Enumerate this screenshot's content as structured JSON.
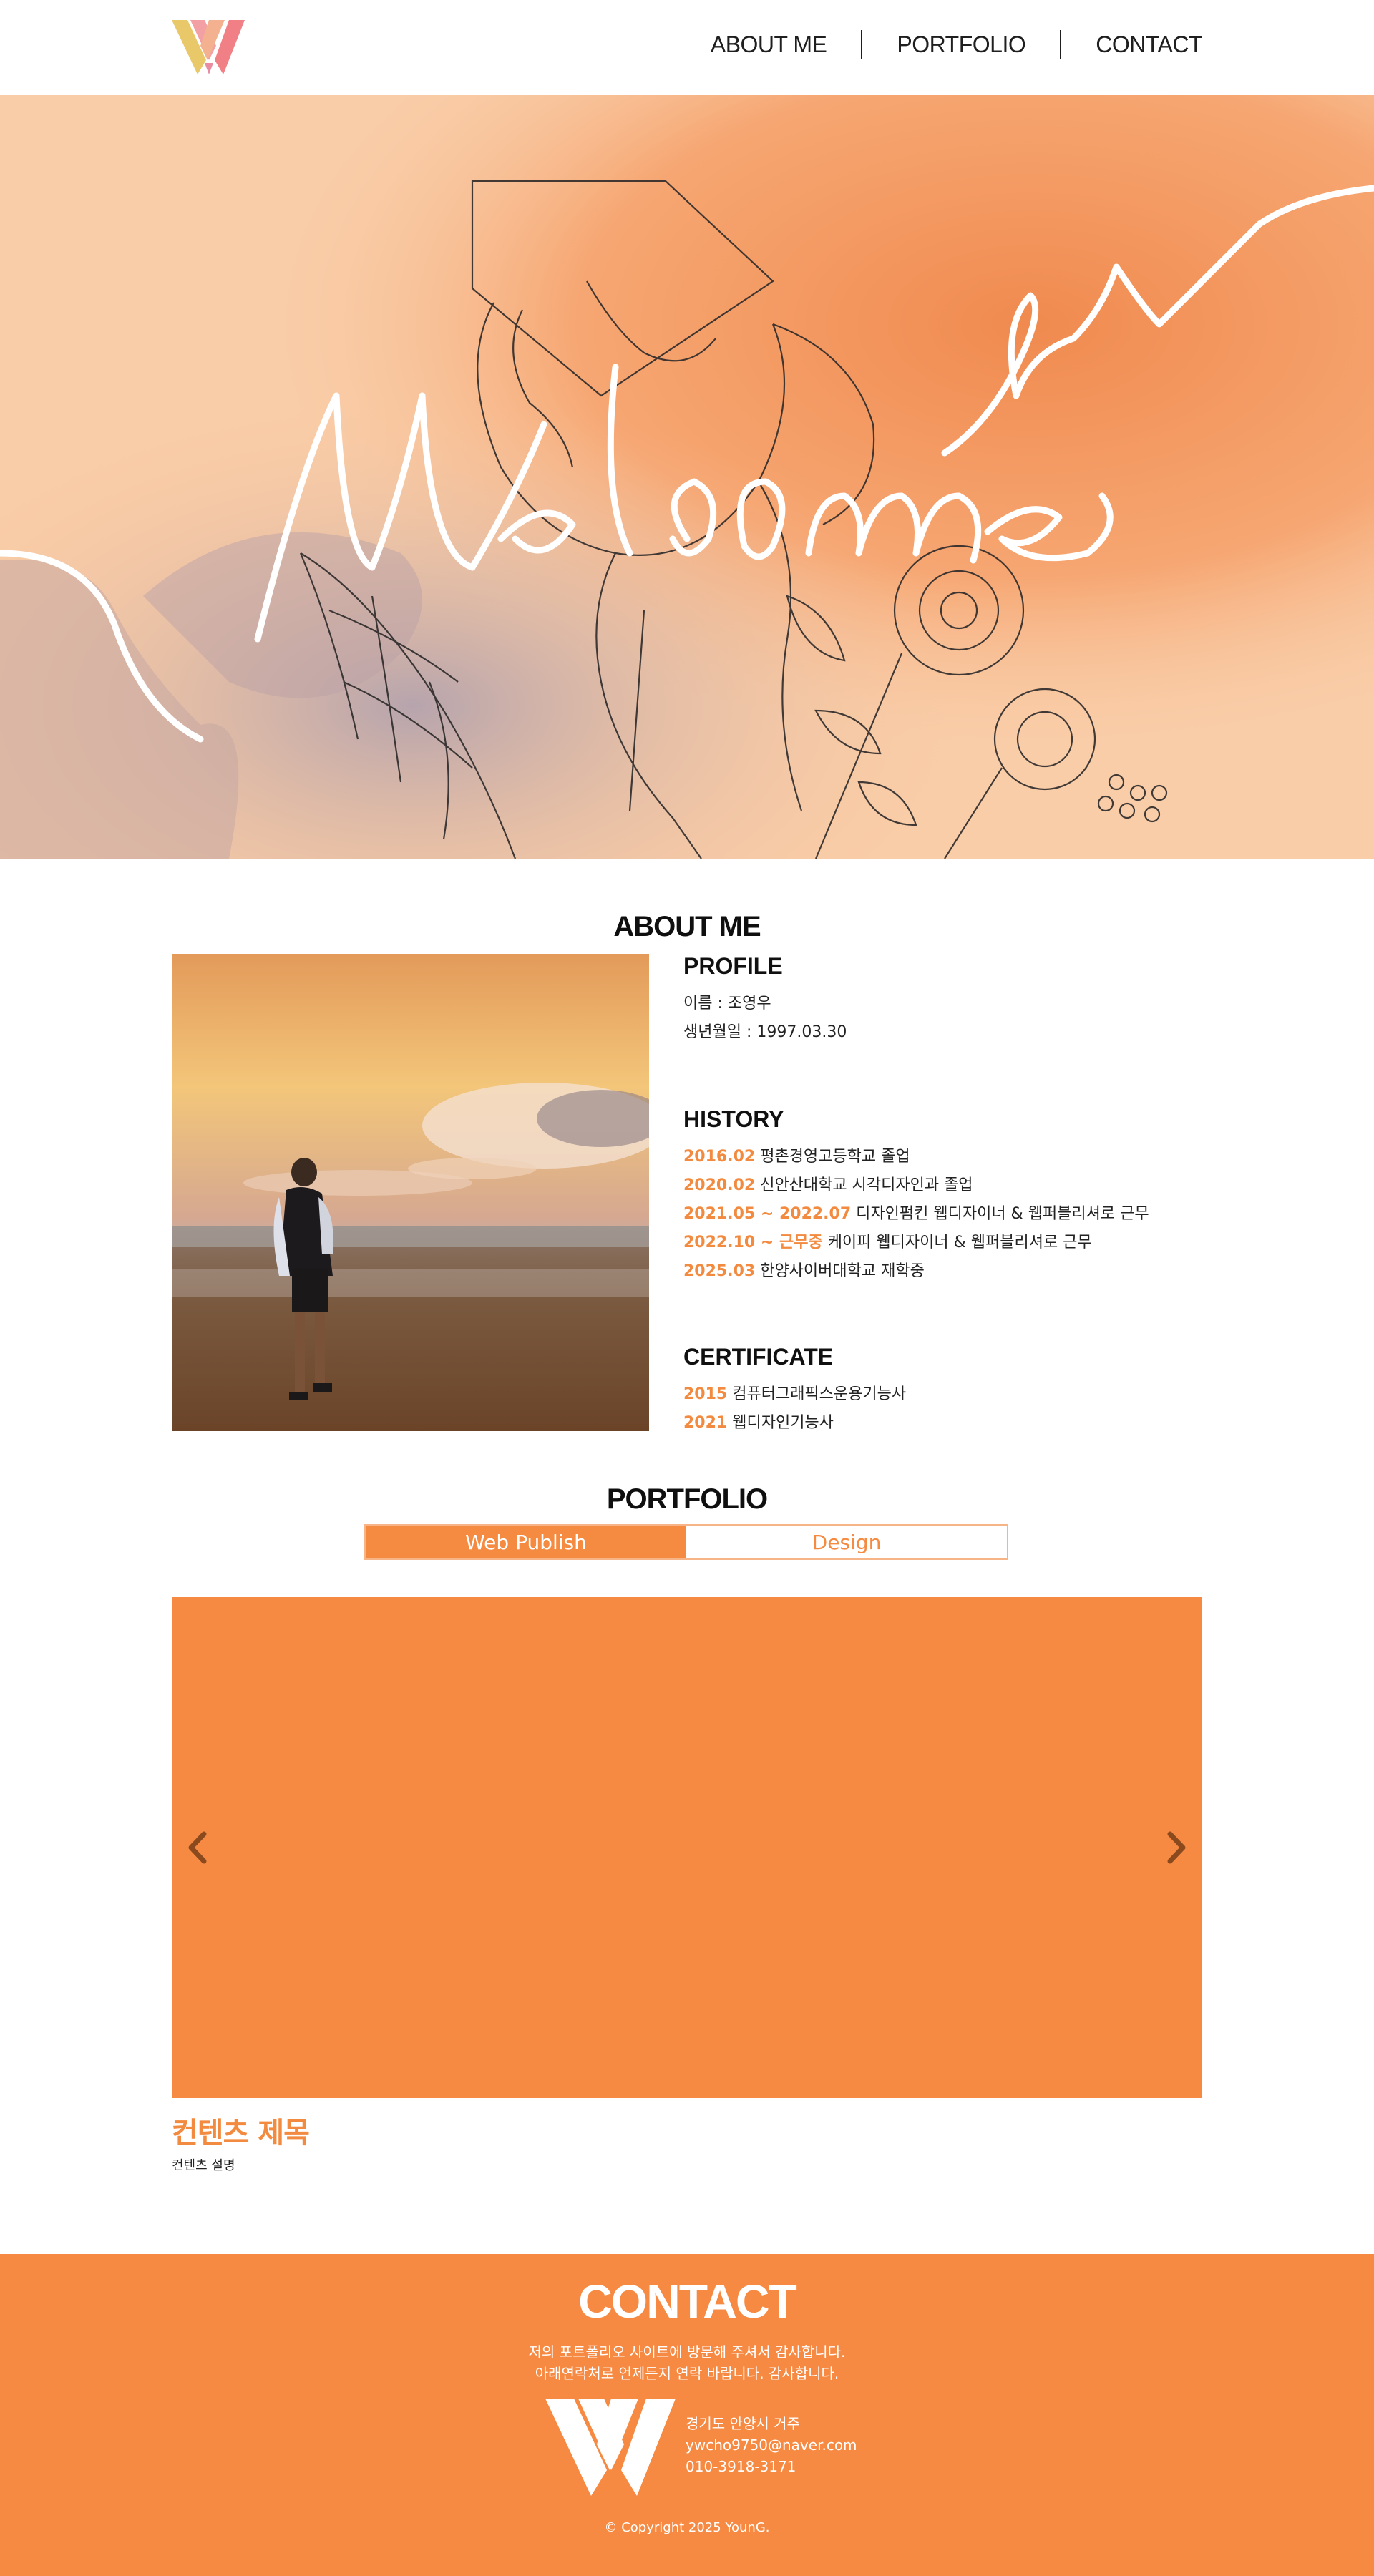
{
  "nav": {
    "about": "ABOUT ME",
    "portfolio": "PORTFOLIO",
    "contact": "CONTACT"
  },
  "about": {
    "title": "ABOUT ME",
    "profile": {
      "title": "PROFILE",
      "name": "이름 : 조영우",
      "birth": "생년월일 : 1997.03.30"
    },
    "history": {
      "title": "HISTORY",
      "items": [
        {
          "date": "2016.02",
          "text": "평촌경영고등학교 졸업"
        },
        {
          "date": "2020.02",
          "text": "신안산대학교 시각디자인과 졸업"
        },
        {
          "date": "2021.05 ~ 2022.07",
          "text": "디자인펌킨 웹디자이너 & 웹퍼블리셔로 근무"
        },
        {
          "date": "2022.10 ~ 근무중",
          "text": "케이피 웹디자이너 & 웹퍼블리셔로 근무"
        },
        {
          "date": "2025.03",
          "text": "한양사이버대학교 재학중"
        }
      ]
    },
    "certificate": {
      "title": "CERTIFICATE",
      "items": [
        {
          "year": "2015",
          "text": "컴퓨터그래픽스운용기능사"
        },
        {
          "year": "2021",
          "text": "웹디자인기능사"
        }
      ]
    }
  },
  "portfolio": {
    "title": "PORTFOLIO",
    "tabs": [
      "Web Publish",
      "Design"
    ],
    "content_title": "컨텐츠 제목",
    "content_desc": "컨텐츠 설명"
  },
  "contact": {
    "title": "CONTACT",
    "desc_line1": "저의 포트폴리오 사이트에 방문해 주셔서 감사합니다.",
    "desc_line2": "아래연락처로 언제든지 연락 바랍니다. 감사합니다.",
    "address": "경기도 안양시 거주",
    "email": "ywcho9750@naver.com",
    "phone": "010-3918-3171",
    "copyright": "© Copyright 2025 YounG."
  },
  "colors": {
    "accent": "#f78a42",
    "accent_text": "#f28a3f",
    "hero_bg": "#f8c39b"
  },
  "icons": {
    "logo": "w-logo-icon",
    "prev": "chevron-left-icon",
    "next": "chevron-right-icon"
  }
}
